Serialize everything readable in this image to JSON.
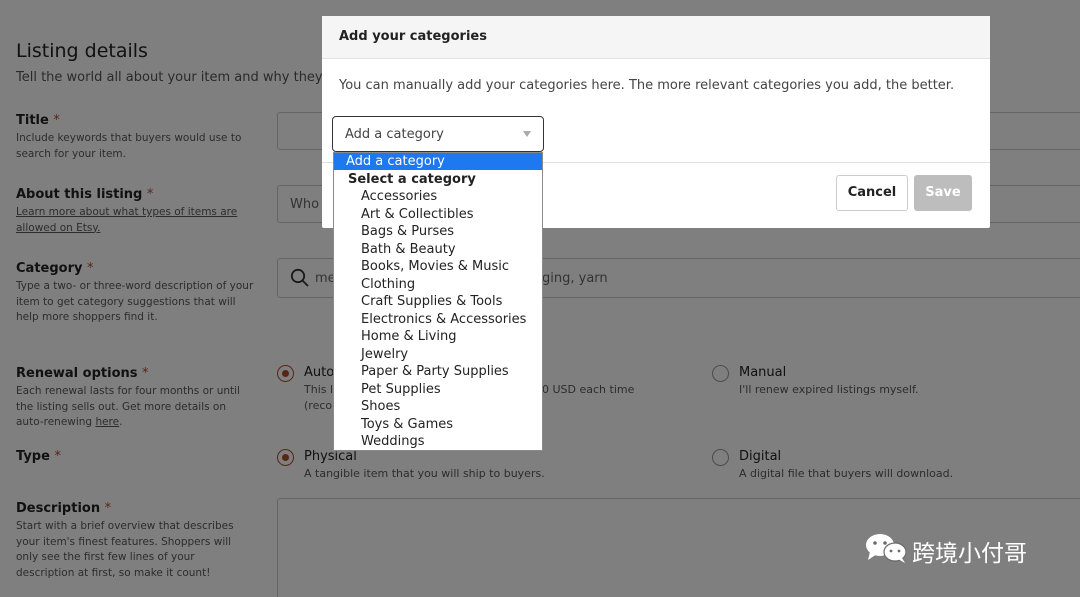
{
  "page": {
    "title": "Listing details",
    "subtitle": "Tell the world all about your item and why they"
  },
  "fields": {
    "title": {
      "label": "Title",
      "required": "*",
      "help": "Include keywords that buyers would use to search for your item."
    },
    "about": {
      "label": "About this listing",
      "required": "*",
      "help": "Learn more about what types of items are allowed on Etsy.",
      "select_value": "Who"
    },
    "category": {
      "label": "Category",
      "required": "*",
      "help": "Type a two- or three-word description of your item to get category suggestions that will help more shoppers find it.",
      "input_left": "me",
      "input_right": "ging, yarn"
    },
    "renewal": {
      "label": "Renewal options",
      "required": "*",
      "help_prefix": "Each renewal lasts for four months or until the listing sells out. Get more details on auto-renewing ",
      "help_link": "here",
      "help_suffix": ".",
      "auto_label": "Auto",
      "auto_desc_1": "This l",
      "auto_desc_2": "(reco",
      "auto_desc_fee": "0 USD each time",
      "manual_label": "Manual",
      "manual_desc": "I'll renew expired listings myself."
    },
    "type": {
      "label": "Type",
      "required": "*",
      "physical_label": "Physical",
      "physical_desc": "A tangible item that you will ship to buyers.",
      "digital_label": "Digital",
      "digital_desc": "A digital file that buyers will download."
    },
    "description": {
      "label": "Description",
      "required": "*",
      "help": "Start with a brief overview that describes your item's finest features. Shoppers will only see the first few lines of your description at first, so make it count!"
    }
  },
  "modal": {
    "title": "Add your categories",
    "info": "You can manually add your categories here. The more relevant categories you add, the better.",
    "select_placeholder": "Add a category",
    "cancel_label": "Cancel",
    "save_label": "Save"
  },
  "dropdown": {
    "highlighted": "Add a category",
    "group_label": "Select a category",
    "options": [
      "Accessories",
      "Art & Collectibles",
      "Bags & Purses",
      "Bath & Beauty",
      "Books, Movies & Music",
      "Clothing",
      "Craft Supplies & Tools",
      "Electronics & Accessories",
      "Home & Living",
      "Jewelry",
      "Paper & Party Supplies",
      "Pet Supplies",
      "Shoes",
      "Toys & Games",
      "Weddings"
    ]
  },
  "watermark": {
    "text": "跨境小付哥",
    "icon": "wechat-logo-icon"
  },
  "colors": {
    "accent": "#b34a2a",
    "highlight": "#1e78f0",
    "overlay": "rgba(0,0,0,0.5)",
    "disabled": "#bdbdbd"
  }
}
